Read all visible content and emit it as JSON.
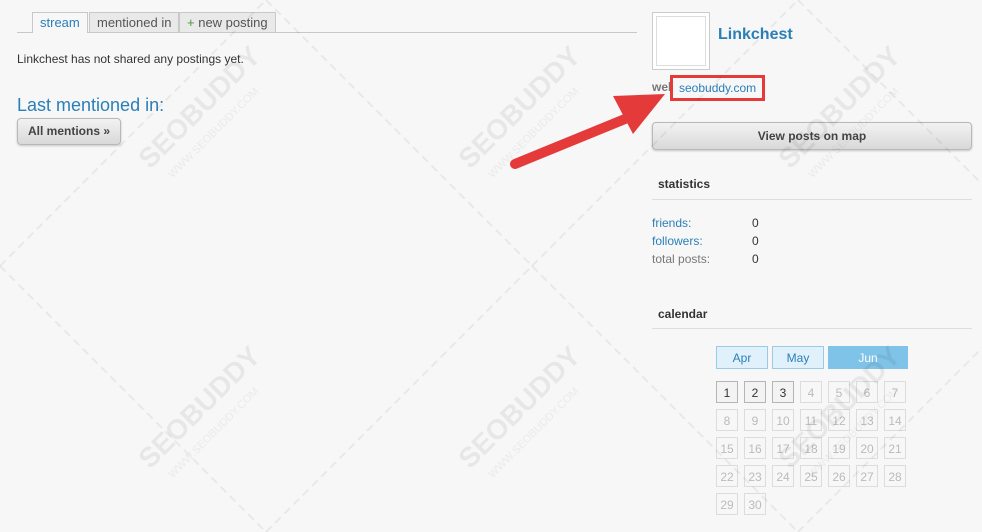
{
  "tabs": [
    {
      "label": "stream"
    },
    {
      "label": "mentioned in"
    },
    {
      "plus": "+",
      "label": "new posting"
    }
  ],
  "main": {
    "empty_message": "Linkchest has not shared any postings yet.",
    "last_mentioned_title": "Last mentioned in:",
    "all_mentions_button": "All mentions »"
  },
  "profile": {
    "name": "Linkchest",
    "web_label": "web",
    "web_link": "seobuddy.com",
    "map_button": "View posts on map"
  },
  "statistics": {
    "title": "statistics",
    "rows": [
      {
        "label": "friends:",
        "value": "0"
      },
      {
        "label": "followers:",
        "value": "0"
      },
      {
        "label": "total posts:",
        "value": "0"
      }
    ]
  },
  "calendar": {
    "title": "calendar",
    "months": [
      "Apr",
      "May",
      "Jun"
    ],
    "active_month": "Jun",
    "days": [
      "1",
      "2",
      "3",
      "4",
      "5",
      "6",
      "7",
      "8",
      "9",
      "10",
      "11",
      "12",
      "13",
      "14",
      "15",
      "16",
      "17",
      "18",
      "19",
      "20",
      "21",
      "22",
      "23",
      "24",
      "25",
      "26",
      "27",
      "28",
      "29",
      "30"
    ],
    "days_with_posts": [
      "1",
      "2",
      "3"
    ]
  },
  "watermark": {
    "brand": "SEOBUDDY",
    "site": "WWW.SEOBUDDY.COM"
  },
  "colors": {
    "link": "#2a7fb8",
    "highlight": "#e53a3a",
    "active_month": "#7fc3e8"
  }
}
